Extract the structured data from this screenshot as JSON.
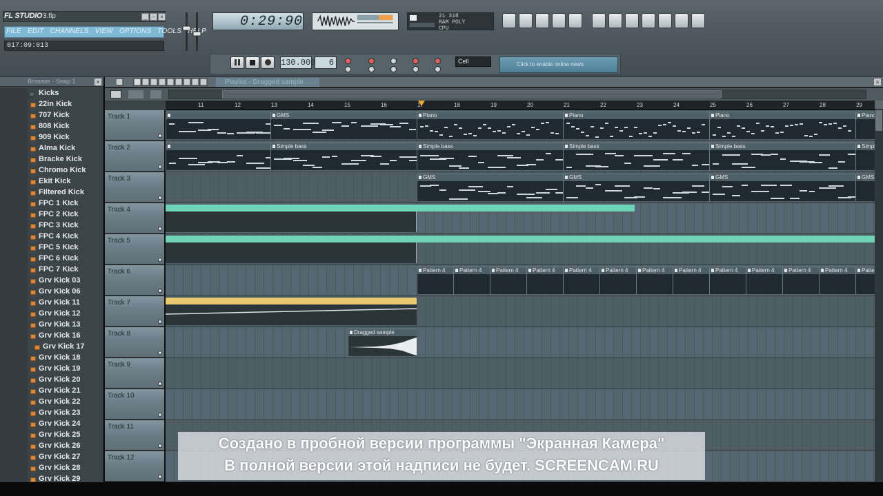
{
  "app": {
    "logo": "FL STUDIO",
    "file_name": "3.flp",
    "menu": [
      "FILE",
      "EDIT",
      "CHANNELS",
      "VIEW",
      "OPTIONS",
      "TOOLS",
      "HELP"
    ],
    "hint": "017:09:013",
    "time": "0:29:90"
  },
  "cpu": {
    "line1": "21   318",
    "line2": "RAM  POLY",
    "line3": "CPU"
  },
  "transport": {
    "bpm": "130.000",
    "pattern": "6",
    "snap": "Cell",
    "news": "Click to enable online news"
  },
  "browser": {
    "title": "Browser - Snap 1",
    "folder": "Kicks",
    "items": [
      "22in Kick",
      "707 Kick",
      "808 Kick",
      "909 Kick",
      "Alma Kick",
      "Bracke Kick",
      "Chromo Kick",
      "Ekit Kick",
      "Filtered Kick",
      "FPC 1 Kick",
      "FPC 2 Kick",
      "FPC 3 Kick",
      "FPC 4 Kick",
      "FPC 5 Kick",
      "FPC 6 Kick",
      "FPC 7 Kick",
      "Grv Kick 03",
      "Grv Kick 06",
      "Grv Kick 11",
      "Grv Kick 12",
      "Grv Kick 13",
      "Grv Kick 16",
      "Grv Kick 17",
      "Grv Kick 18",
      "Grv Kick 19",
      "Grv Kick 20",
      "Grv Kick 21",
      "Grv Kick 22",
      "Grv Kick 23",
      "Grv Kick 24",
      "Grv Kick 25",
      "Grv Kick 26",
      "Grv Kick 27",
      "Grv Kick 28",
      "Grv Kick 29"
    ],
    "selected_index": 22
  },
  "playlist": {
    "title": "Playlist - Dragged sample",
    "ruler": [
      "11",
      "12",
      "13",
      "14",
      "15",
      "16",
      "17",
      "18",
      "19",
      "20",
      "21",
      "22",
      "23",
      "24",
      "25",
      "26",
      "27",
      "28",
      "29"
    ],
    "tracks": [
      "Track 1",
      "Track 2",
      "Track 3",
      "Track 4",
      "Track 5",
      "Track 6",
      "Track 7",
      "Track 8",
      "Track 9",
      "Track 10",
      "Track 11",
      "Track 12"
    ],
    "clip_labels": {
      "gms": "GMS",
      "piano": "Piano",
      "simple_bass": "Simple bass",
      "pattern4": "Pattern 4",
      "dragged": "Dragged sample"
    }
  },
  "colors": {
    "audio_clip": "#6fd3b5",
    "automation_clip": "#e8c871",
    "accent": "#7fb9d6"
  },
  "watermark": {
    "line1": "Создано в пробной версии программы \"Экранная Камера\"",
    "line2": "В полной версии этой надписи не будет. SCREENCAM.RU"
  }
}
